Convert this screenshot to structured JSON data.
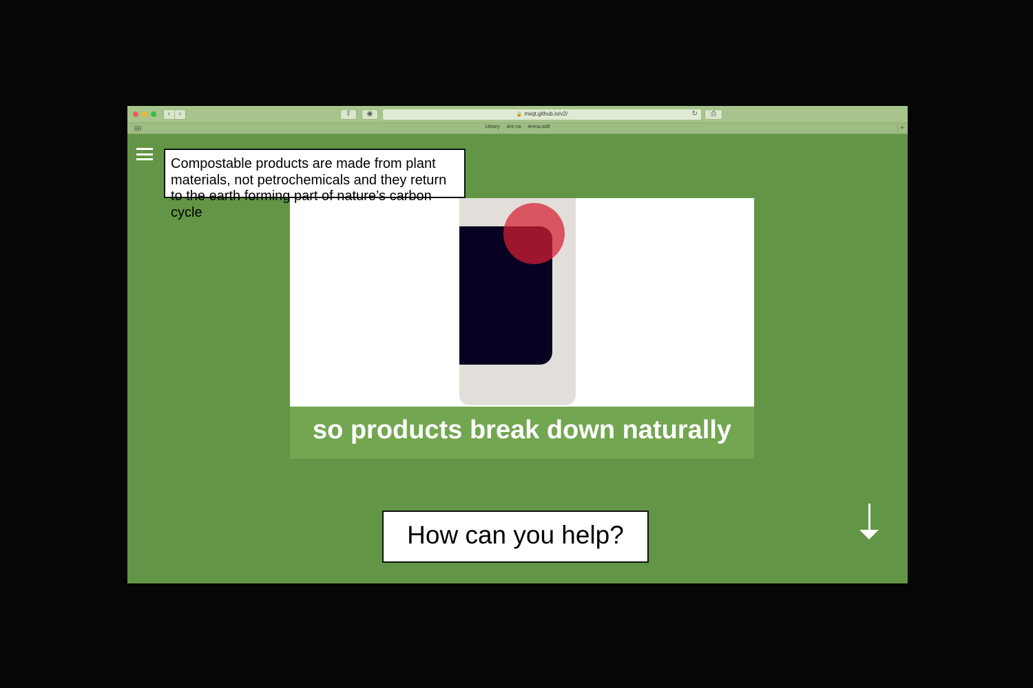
{
  "browser": {
    "nav_back_icon": "chevron-left-icon",
    "nav_back": "‹",
    "nav_forward_icon": "chevron-right-icon",
    "nav_forward": "›",
    "share_glyph": "⇪",
    "stop_glyph": "◉",
    "print_glyph": "⎙",
    "lock_glyph": "🔒",
    "reload_glyph": "↻",
    "url": "mxqt.github.io/v2/",
    "bookmarks": [
      "Library",
      "Are.na",
      "Arena.add"
    ],
    "new_tab_glyph": "+"
  },
  "page": {
    "info_text": "Compostable products are made from plant materials, not petrochemicals and they return to the earth forming part of nature’s carbon cycle",
    "caption": "so products break down naturally",
    "cta_label": "How can you help?"
  },
  "colors": {
    "background": "#629646",
    "caption_band": "#73a650",
    "dark_shape": "#070221",
    "red_circle": "#d81e32"
  }
}
